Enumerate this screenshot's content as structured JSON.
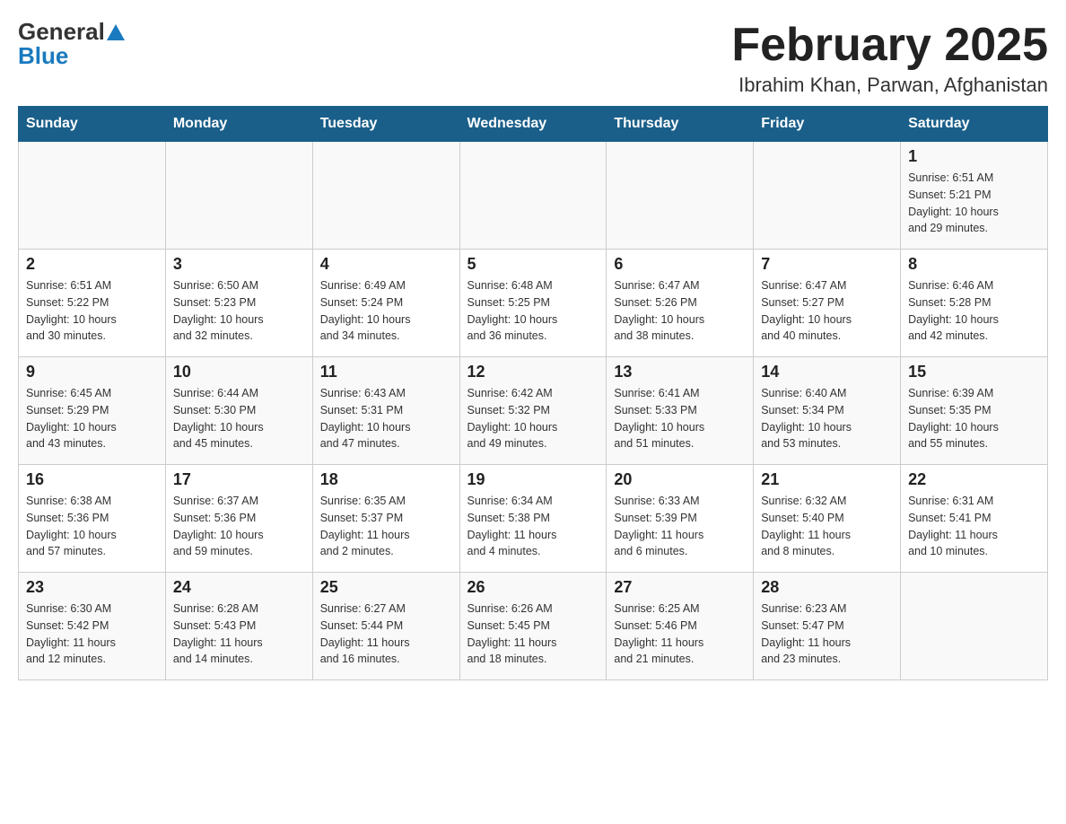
{
  "logo": {
    "general": "General",
    "blue": "Blue"
  },
  "title": "February 2025",
  "location": "Ibrahim Khan, Parwan, Afghanistan",
  "days_of_week": [
    "Sunday",
    "Monday",
    "Tuesday",
    "Wednesday",
    "Thursday",
    "Friday",
    "Saturday"
  ],
  "weeks": [
    {
      "id": "week1",
      "days": [
        {
          "num": "",
          "info": ""
        },
        {
          "num": "",
          "info": ""
        },
        {
          "num": "",
          "info": ""
        },
        {
          "num": "",
          "info": ""
        },
        {
          "num": "",
          "info": ""
        },
        {
          "num": "",
          "info": ""
        },
        {
          "num": "1",
          "info": "Sunrise: 6:51 AM\nSunset: 5:21 PM\nDaylight: 10 hours\nand 29 minutes."
        }
      ]
    },
    {
      "id": "week2",
      "days": [
        {
          "num": "2",
          "info": "Sunrise: 6:51 AM\nSunset: 5:22 PM\nDaylight: 10 hours\nand 30 minutes."
        },
        {
          "num": "3",
          "info": "Sunrise: 6:50 AM\nSunset: 5:23 PM\nDaylight: 10 hours\nand 32 minutes."
        },
        {
          "num": "4",
          "info": "Sunrise: 6:49 AM\nSunset: 5:24 PM\nDaylight: 10 hours\nand 34 minutes."
        },
        {
          "num": "5",
          "info": "Sunrise: 6:48 AM\nSunset: 5:25 PM\nDaylight: 10 hours\nand 36 minutes."
        },
        {
          "num": "6",
          "info": "Sunrise: 6:47 AM\nSunset: 5:26 PM\nDaylight: 10 hours\nand 38 minutes."
        },
        {
          "num": "7",
          "info": "Sunrise: 6:47 AM\nSunset: 5:27 PM\nDaylight: 10 hours\nand 40 minutes."
        },
        {
          "num": "8",
          "info": "Sunrise: 6:46 AM\nSunset: 5:28 PM\nDaylight: 10 hours\nand 42 minutes."
        }
      ]
    },
    {
      "id": "week3",
      "days": [
        {
          "num": "9",
          "info": "Sunrise: 6:45 AM\nSunset: 5:29 PM\nDaylight: 10 hours\nand 43 minutes."
        },
        {
          "num": "10",
          "info": "Sunrise: 6:44 AM\nSunset: 5:30 PM\nDaylight: 10 hours\nand 45 minutes."
        },
        {
          "num": "11",
          "info": "Sunrise: 6:43 AM\nSunset: 5:31 PM\nDaylight: 10 hours\nand 47 minutes."
        },
        {
          "num": "12",
          "info": "Sunrise: 6:42 AM\nSunset: 5:32 PM\nDaylight: 10 hours\nand 49 minutes."
        },
        {
          "num": "13",
          "info": "Sunrise: 6:41 AM\nSunset: 5:33 PM\nDaylight: 10 hours\nand 51 minutes."
        },
        {
          "num": "14",
          "info": "Sunrise: 6:40 AM\nSunset: 5:34 PM\nDaylight: 10 hours\nand 53 minutes."
        },
        {
          "num": "15",
          "info": "Sunrise: 6:39 AM\nSunset: 5:35 PM\nDaylight: 10 hours\nand 55 minutes."
        }
      ]
    },
    {
      "id": "week4",
      "days": [
        {
          "num": "16",
          "info": "Sunrise: 6:38 AM\nSunset: 5:36 PM\nDaylight: 10 hours\nand 57 minutes."
        },
        {
          "num": "17",
          "info": "Sunrise: 6:37 AM\nSunset: 5:36 PM\nDaylight: 10 hours\nand 59 minutes."
        },
        {
          "num": "18",
          "info": "Sunrise: 6:35 AM\nSunset: 5:37 PM\nDaylight: 11 hours\nand 2 minutes."
        },
        {
          "num": "19",
          "info": "Sunrise: 6:34 AM\nSunset: 5:38 PM\nDaylight: 11 hours\nand 4 minutes."
        },
        {
          "num": "20",
          "info": "Sunrise: 6:33 AM\nSunset: 5:39 PM\nDaylight: 11 hours\nand 6 minutes."
        },
        {
          "num": "21",
          "info": "Sunrise: 6:32 AM\nSunset: 5:40 PM\nDaylight: 11 hours\nand 8 minutes."
        },
        {
          "num": "22",
          "info": "Sunrise: 6:31 AM\nSunset: 5:41 PM\nDaylight: 11 hours\nand 10 minutes."
        }
      ]
    },
    {
      "id": "week5",
      "days": [
        {
          "num": "23",
          "info": "Sunrise: 6:30 AM\nSunset: 5:42 PM\nDaylight: 11 hours\nand 12 minutes."
        },
        {
          "num": "24",
          "info": "Sunrise: 6:28 AM\nSunset: 5:43 PM\nDaylight: 11 hours\nand 14 minutes."
        },
        {
          "num": "25",
          "info": "Sunrise: 6:27 AM\nSunset: 5:44 PM\nDaylight: 11 hours\nand 16 minutes."
        },
        {
          "num": "26",
          "info": "Sunrise: 6:26 AM\nSunset: 5:45 PM\nDaylight: 11 hours\nand 18 minutes."
        },
        {
          "num": "27",
          "info": "Sunrise: 6:25 AM\nSunset: 5:46 PM\nDaylight: 11 hours\nand 21 minutes."
        },
        {
          "num": "28",
          "info": "Sunrise: 6:23 AM\nSunset: 5:47 PM\nDaylight: 11 hours\nand 23 minutes."
        },
        {
          "num": "",
          "info": ""
        }
      ]
    }
  ]
}
